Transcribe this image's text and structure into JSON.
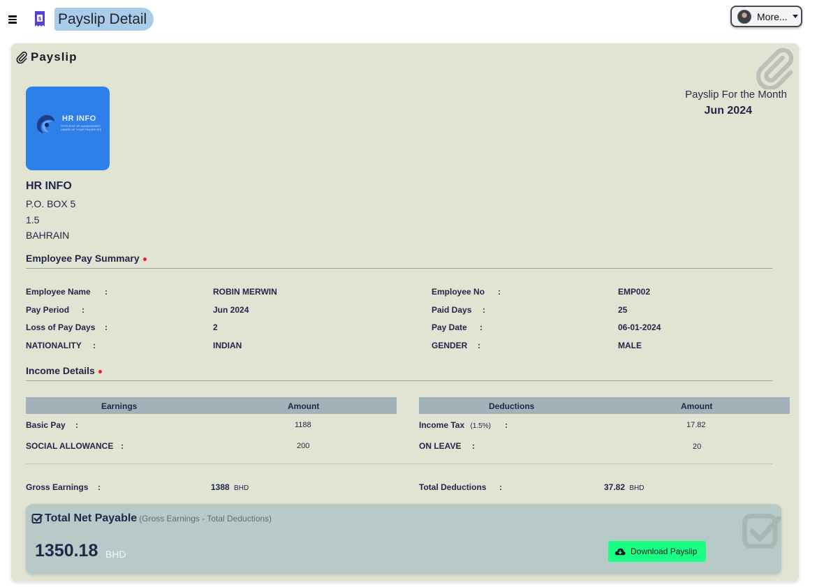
{
  "header": {
    "title": "Payslip Detail",
    "more_label": "More...",
    "menu_icon": "hamburger-icon",
    "page_icon": "receipt-icon"
  },
  "card": {
    "title": "Payslip",
    "company": {
      "logo_title": "HR INFO",
      "logo_subtitle": "EFFICIENT HR MANAGEMENT UNDER OF YOUR FINGERTIPS",
      "name": "HR INFO",
      "address_line1": "P.O. BOX 5",
      "address_line2": "1.5",
      "address_line3": "BAHRAIN"
    },
    "month_label": "Payslip For the Month",
    "month_value": "Jun 2024"
  },
  "summary": {
    "title": "Employee Pay Summary",
    "fields": [
      {
        "label": "Employee Name",
        "value": "ROBIN MERWIN"
      },
      {
        "label": "Employee No",
        "value": "EMP002"
      },
      {
        "label": "Pay Period",
        "value": "Jun 2024"
      },
      {
        "label": "Paid Days",
        "value": "25"
      },
      {
        "label": "Loss of Pay Days",
        "value": "2"
      },
      {
        "label": "Pay Date",
        "value": "06-01-2024"
      },
      {
        "label": "NATIONALITY",
        "value": "INDIAN"
      },
      {
        "label": "GENDER",
        "value": "MALE"
      }
    ]
  },
  "income": {
    "title": "Income Details",
    "earnings_header": "Earnings",
    "earnings_amount_header": "Amount",
    "deductions_header": "Deductions",
    "deductions_amount_header": "Amount",
    "earnings": [
      {
        "label": "Basic Pay",
        "amount": "1188"
      },
      {
        "label": "SOCIAL ALLOWANCE",
        "amount": "200"
      }
    ],
    "deductions": [
      {
        "label": "Income Tax",
        "note": "(1.5%)",
        "amount": "17.82"
      },
      {
        "label": "ON LEAVE",
        "note": "",
        "amount": "20"
      }
    ],
    "gross_label": "Gross Earnings",
    "gross_value": "1388",
    "gross_currency": "BHD",
    "total_ded_label": "Total Deductions",
    "total_ded_value": "37.82",
    "total_ded_currency": "BHD"
  },
  "net": {
    "title": "Total Net Payable",
    "subtitle": "(Gross Earnings - Total Deductions)",
    "amount": "1350.18",
    "currency": "BHD",
    "download_label": "Download Payslip"
  },
  "colon": ":"
}
